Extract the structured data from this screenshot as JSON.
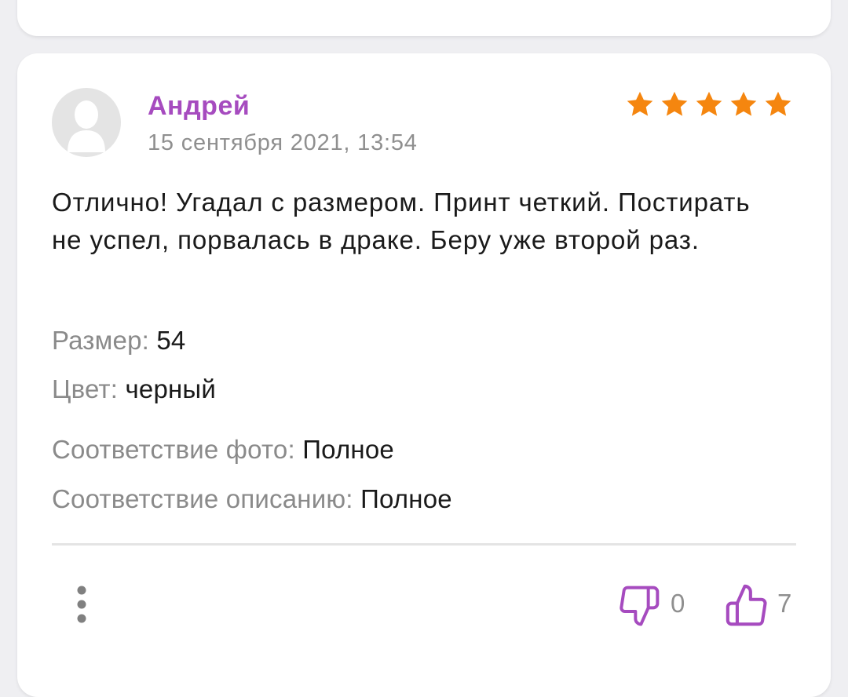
{
  "review": {
    "author": "Андрей",
    "date": "15 сентября 2021, 13:54",
    "rating": 5,
    "text": "Отлично! Угадал с размером. Принт четкий. Постирать не успел, порвалась в драке. Беру уже второй раз.",
    "attributes": [
      {
        "label": "Размер:",
        "value": "54"
      },
      {
        "label": "Цвет:",
        "value": "черный"
      },
      {
        "label": "Соответствие фото:",
        "value": "Полное"
      },
      {
        "label": "Соответствие описанию:",
        "value": "Полное"
      }
    ],
    "dislikes": "0",
    "likes": "7"
  },
  "icons": {
    "avatar": "avatar-placeholder-icon",
    "star": "star-icon",
    "more": "more-vertical-icon",
    "dislike": "thumbs-down-icon",
    "like": "thumbs-up-icon"
  },
  "colors": {
    "accent": "#a64bbf",
    "star": "#f5860f",
    "background": "#efeff2"
  }
}
